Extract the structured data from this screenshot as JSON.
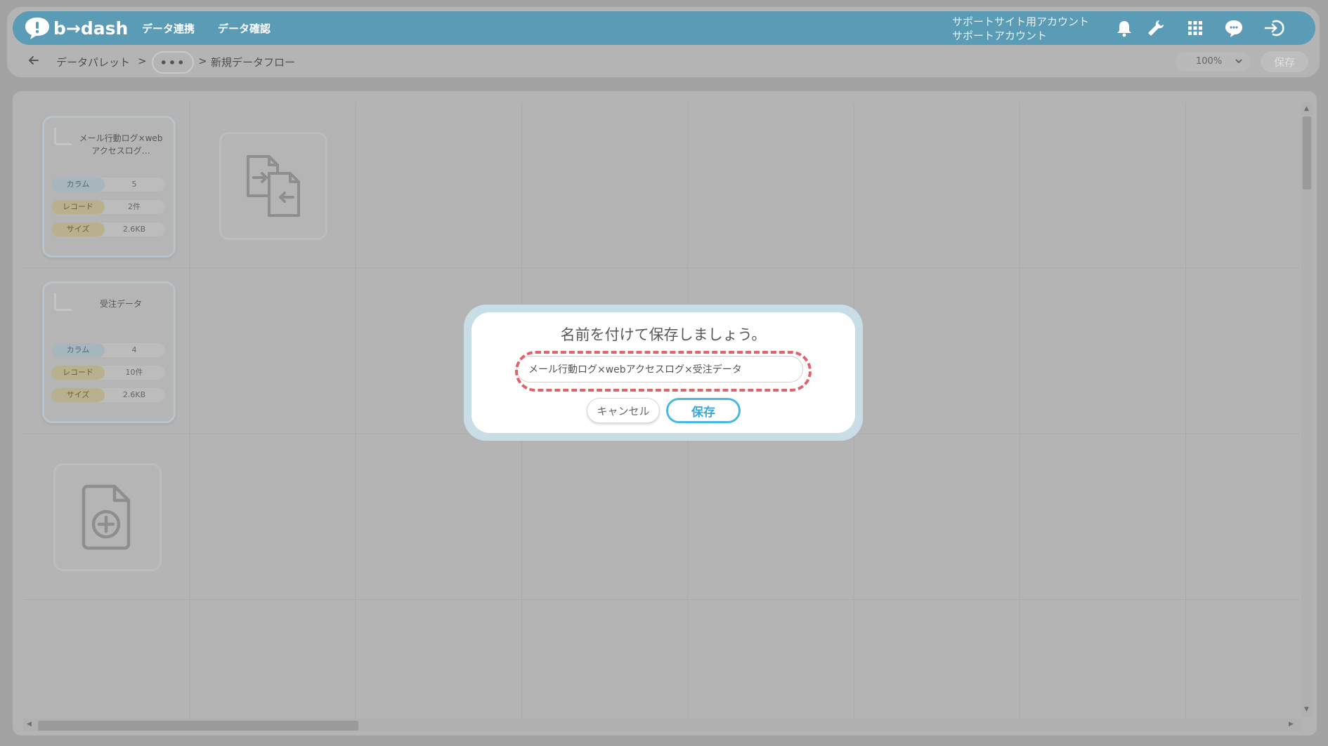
{
  "app": {
    "logo_text": "b→dash"
  },
  "nav": [
    {
      "label": "データ連携"
    },
    {
      "label": "データ確認"
    }
  ],
  "account": {
    "line1": "サポートサイト用アカウント",
    "line2": "サポートアカウント"
  },
  "header_icons": [
    "bell-icon",
    "wrench-icon",
    "grid-icon",
    "support-icon",
    "logout-icon"
  ],
  "breadcrumb": {
    "root": "データパレット",
    "separator": ">",
    "ellipsis": "•••",
    "current": "新規データフロー"
  },
  "toolbar": {
    "zoom": "100%",
    "save_label": "保存"
  },
  "cards": [
    {
      "title": "メール行動ログ×webアクセスログ…",
      "stats": [
        {
          "label": "カラム",
          "value": "5"
        },
        {
          "label": "レコード",
          "value": "2件"
        },
        {
          "label": "サイズ",
          "value": "2.6KB"
        }
      ]
    },
    {
      "title": "受注データ",
      "stats": [
        {
          "label": "カラム",
          "value": "4"
        },
        {
          "label": "レコード",
          "value": "10件"
        },
        {
          "label": "サイズ",
          "value": "2.6KB"
        }
      ]
    }
  ],
  "modal": {
    "title": "名前を付けて保存しましょう。",
    "input_value": "メール行動ログ×webアクセスログ×受注データ",
    "cancel_label": "キャンセル",
    "save_label": "保存"
  },
  "colors": {
    "header": "#5a9cb5",
    "accent": "#47b8e0",
    "highlight": "#e0636b"
  }
}
